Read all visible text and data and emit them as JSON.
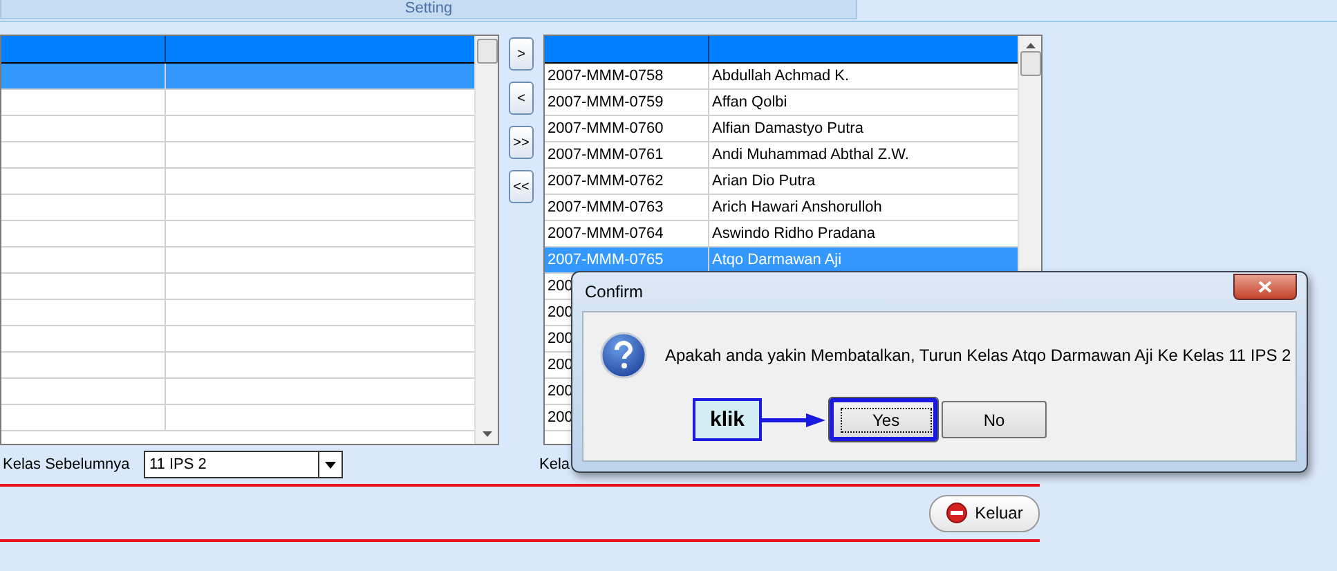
{
  "tab": {
    "label": "Setting"
  },
  "left_grid": {
    "rows": [
      {
        "selected": true
      },
      {
        "selected": false
      },
      {
        "selected": false
      },
      {
        "selected": false
      },
      {
        "selected": false
      },
      {
        "selected": false
      },
      {
        "selected": false
      },
      {
        "selected": false
      },
      {
        "selected": false
      },
      {
        "selected": false
      },
      {
        "selected": false
      },
      {
        "selected": false
      },
      {
        "selected": false
      },
      {
        "selected": false
      }
    ]
  },
  "move_buttons": [
    ">",
    "<",
    ">>",
    "<<"
  ],
  "right_grid": {
    "rows": [
      {
        "id": "2007-MMM-0758",
        "name": "Abdullah Achmad K.",
        "selected": false
      },
      {
        "id": "2007-MMM-0759",
        "name": "Affan Qolbi",
        "selected": false
      },
      {
        "id": "2007-MMM-0760",
        "name": "Alfian Damastyo Putra",
        "selected": false
      },
      {
        "id": "2007-MMM-0761",
        "name": "Andi Muhammad Abthal Z.W.",
        "selected": false
      },
      {
        "id": "2007-MMM-0762",
        "name": "Arian Dio Putra",
        "selected": false
      },
      {
        "id": "2007-MMM-0763",
        "name": "Arich Hawari Anshorulloh",
        "selected": false
      },
      {
        "id": "2007-MMM-0764",
        "name": "Aswindo Ridho Pradana",
        "selected": false
      },
      {
        "id": "2007-MMM-0765",
        "name": "Atqo Darmawan Aji",
        "selected": true
      },
      {
        "id": "200",
        "selected": false
      },
      {
        "id": "200",
        "selected": false
      },
      {
        "id": "200",
        "selected": false
      },
      {
        "id": "200",
        "selected": false
      },
      {
        "id": "200",
        "selected": false
      },
      {
        "id": "200",
        "selected": false
      }
    ]
  },
  "previous_class": {
    "label": "Kelas Sebelumnya",
    "value": "11 IPS 2"
  },
  "next_class": {
    "label": "Kela"
  },
  "exit_button": "Keluar",
  "dialog": {
    "title": "Confirm",
    "message": "Apakah anda yakin Membatalkan, Turun Kelas Atqo Darmawan Aji Ke Kelas 11 IPS 2",
    "buttons": [
      {
        "label": "Yes",
        "selected": true
      },
      {
        "label": "No",
        "selected": false
      }
    ],
    "callout": "klik"
  }
}
